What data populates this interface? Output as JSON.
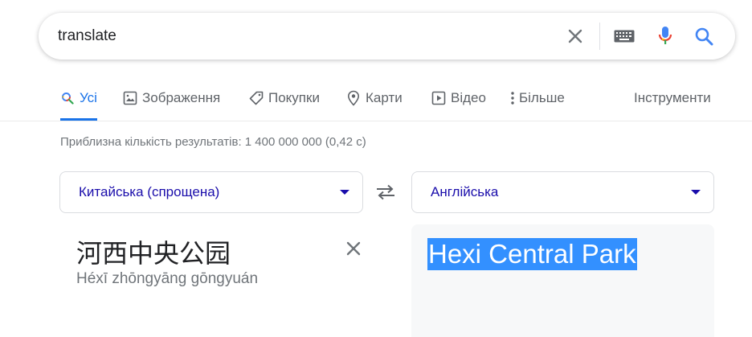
{
  "search": {
    "query": "translate",
    "icons": [
      "clear-icon",
      "keyboard-icon",
      "mic-icon",
      "search-icon"
    ]
  },
  "tabs": [
    {
      "label": "Усі",
      "icon": "search-icon",
      "active": true
    },
    {
      "label": "Зображення",
      "icon": "image-icon"
    },
    {
      "label": "Покупки",
      "icon": "tag-icon"
    },
    {
      "label": "Карти",
      "icon": "map-pin-icon"
    },
    {
      "label": "Відео",
      "icon": "video-icon"
    },
    {
      "label": "Більше",
      "icon": "more-vert-icon"
    }
  ],
  "tools_label": "Інструменти",
  "result_stats": "Приблизна кількість результатів: 1 400 000 000 (0,42 с)",
  "translator": {
    "source_language": "Китайська (спрощена)",
    "target_language": "Англійська",
    "source_text": "河西中央公园",
    "source_transliteration": "Héxī zhōngyāng gōngyuán",
    "translated_text": "Hexi Central Park"
  },
  "colors": {
    "accent_blue": "#1a73e8",
    "link_blue": "#1a0dab",
    "selection_blue": "#3390ff",
    "muted_gray": "#70757a"
  }
}
